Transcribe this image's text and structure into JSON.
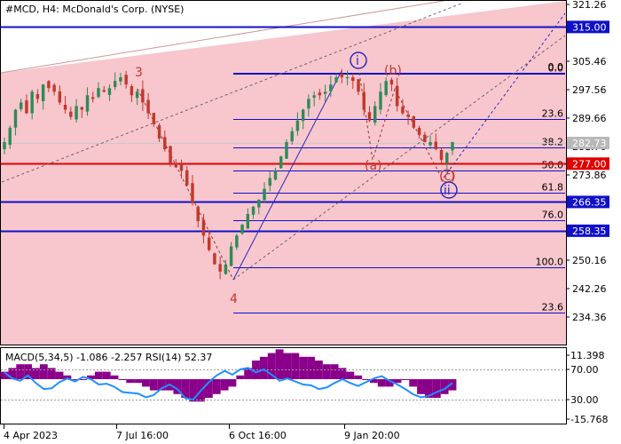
{
  "window": {
    "title": "#MCD, H4:  McDonald's Corp. (NYSE)",
    "indicator_title": "MACD(5,34,5) -1.086 -2.257 RSI(14) 52.37"
  },
  "colors": {
    "bg": "#ffffff",
    "channel_fill": "#f8c6cd",
    "bull_candle": "#2e8b57",
    "bear_candle": "#c0392b",
    "level_blue": "#1010c8",
    "level_red": "#e00000",
    "wave_red": "#c0392b",
    "wave_blue": "#2a2abf",
    "macd_hist": "#8b008b",
    "macd_signal": "#1e90ff",
    "current_price_box": "#b8b8b8",
    "red_price_box": "#e00000",
    "blue_price_box": "#1010c8"
  },
  "chart_data": {
    "type": "line",
    "title": "#MCD, H4:  McDonald's Corp. (NYSE)",
    "price_axis": {
      "min": 234.36,
      "max": 321.26,
      "tick_labels": [
        "321.26",
        "305.46",
        "297.56",
        "289.66",
        "281.76",
        "273.86",
        "250.16",
        "242.26",
        "234.36"
      ]
    },
    "time_axis": {
      "tick_labels": [
        "4 Apr 2023",
        "7 Jul 16:00",
        "6 Oct 16:00",
        "9 Jan 20:00"
      ]
    },
    "current_price": "282.73",
    "price_levels": [
      {
        "price": 315.0,
        "label": "315.00",
        "color": "blue"
      },
      {
        "price": 277.0,
        "label": "277.00",
        "color": "red"
      },
      {
        "price": 266.35,
        "label": "266.35",
        "color": "blue"
      },
      {
        "price": 258.35,
        "label": "258.35",
        "color": "blue"
      }
    ],
    "fibonacci": [
      {
        "level": "0.0",
        "price": 302.1
      },
      {
        "level": "23.6",
        "price": 289.4
      },
      {
        "level": "38.2",
        "price": 281.55
      },
      {
        "level": "50.0",
        "price": 275.1
      },
      {
        "level": "61.8",
        "price": 268.8
      },
      {
        "level": "76.0",
        "price": 261.15
      },
      {
        "level": "100.0",
        "price": 248.2
      },
      {
        "level": "23.6",
        "price": 235.6
      }
    ],
    "fib_top_label": "0.0",
    "wave_labels": {
      "three": "3",
      "four": "4",
      "i": "i",
      "ii": "ii",
      "a": "(a)",
      "b": "(b)",
      "c": "(c)"
    },
    "series": [
      {
        "name": "MCD H4 close",
        "values": [
          283,
          287,
          292,
          294,
          291,
          297,
          295,
          299,
          298,
          297,
          294,
          292,
          290,
          293,
          292,
          296,
          295,
          298,
          297,
          298,
          300,
          301,
          299,
          296,
          297,
          294,
          291,
          288,
          284,
          281,
          277,
          276,
          275,
          271,
          266,
          261,
          257,
          253,
          249,
          247,
          249,
          254,
          257,
          260,
          263,
          265,
          267,
          270,
          273,
          275,
          279,
          283,
          286,
          289,
          292,
          295,
          296,
          296,
          297,
          299,
          301,
          301,
          301,
          300,
          297,
          292,
          289,
          293,
          297,
          300,
          299,
          293,
          291,
          290,
          287,
          285,
          283,
          283,
          281,
          278,
          280,
          283
        ]
      }
    ],
    "indicator": {
      "name": "MACD(5,34,5) RSI(14)",
      "macd_value": "-1.086",
      "signal_value": "-2.257",
      "rsi_value": "52.37",
      "axis_labels": [
        "11.398",
        "70.00",
        "30.00",
        "-15.768"
      ],
      "histogram": [
        2,
        3,
        4,
        4,
        3,
        4,
        3,
        2,
        1,
        0,
        0,
        1,
        2,
        2,
        1,
        0,
        -1,
        -1,
        -2,
        -3,
        -3,
        -3,
        -4,
        -5,
        -6,
        -6,
        -5,
        -4,
        -3,
        -2,
        1,
        3,
        5,
        6,
        7,
        8,
        7,
        7,
        6,
        6,
        5,
        4,
        4,
        3,
        2,
        1,
        0,
        -1,
        -2,
        -2,
        -1,
        0,
        -2,
        -4,
        -5,
        -5,
        -4,
        -3
      ],
      "rsi": [
        66,
        58,
        55,
        62,
        52,
        44,
        45,
        53,
        58,
        54,
        60,
        57,
        50,
        51,
        47,
        40,
        39,
        38,
        33,
        36,
        45,
        50,
        44,
        32,
        30,
        42,
        53,
        62,
        68,
        63,
        70,
        72,
        66,
        70,
        63,
        55,
        58,
        54,
        50,
        49,
        44,
        46,
        52,
        57,
        52,
        48,
        53,
        58,
        61,
        55,
        50,
        44,
        37,
        33,
        35,
        40,
        44,
        52
      ]
    }
  }
}
